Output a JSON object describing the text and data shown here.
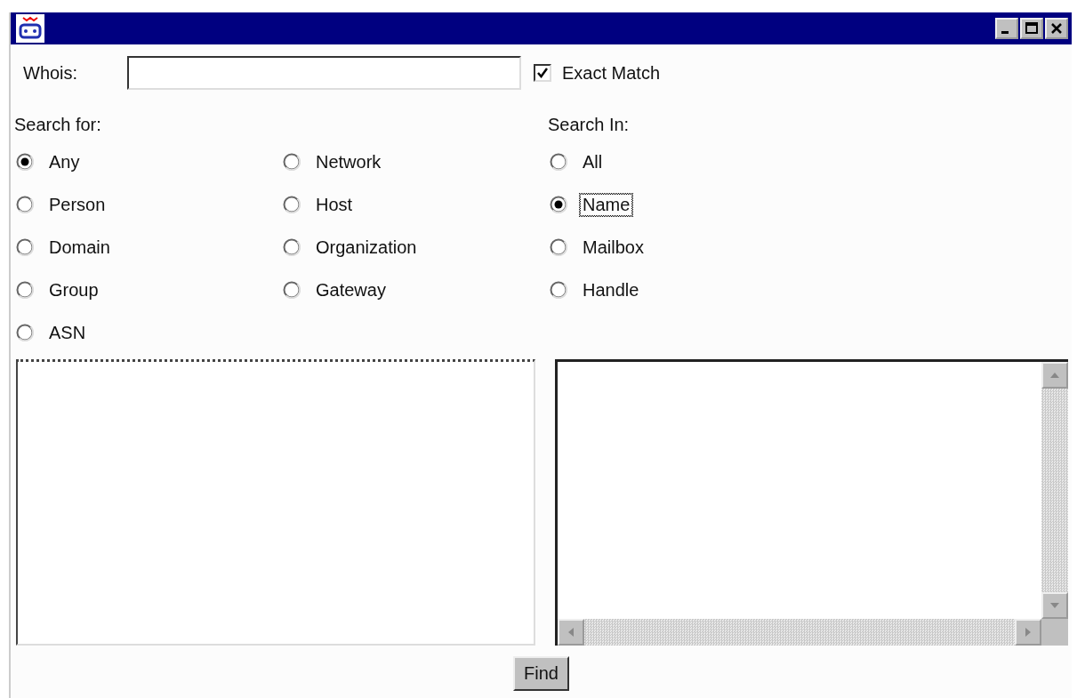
{
  "whois": {
    "label": "Whois:"
  },
  "exact_match": {
    "label": "Exact Match",
    "checked": true
  },
  "search_for": {
    "label": "Search for:",
    "options": [
      {
        "label": "Any",
        "selected": true
      },
      {
        "label": "Person",
        "selected": false
      },
      {
        "label": "Domain",
        "selected": false
      },
      {
        "label": "Group",
        "selected": false
      },
      {
        "label": "ASN",
        "selected": false
      },
      {
        "label": "Network",
        "selected": false
      },
      {
        "label": "Host",
        "selected": false
      },
      {
        "label": "Organization",
        "selected": false
      },
      {
        "label": "Gateway",
        "selected": false
      }
    ]
  },
  "search_in": {
    "label": "Search In:",
    "options": [
      {
        "label": "All",
        "selected": false,
        "focused": false
      },
      {
        "label": "Name",
        "selected": true,
        "focused": true
      },
      {
        "label": "Mailbox",
        "selected": false,
        "focused": false
      },
      {
        "label": "Handle",
        "selected": false,
        "focused": false
      }
    ]
  },
  "find_button": "Find"
}
